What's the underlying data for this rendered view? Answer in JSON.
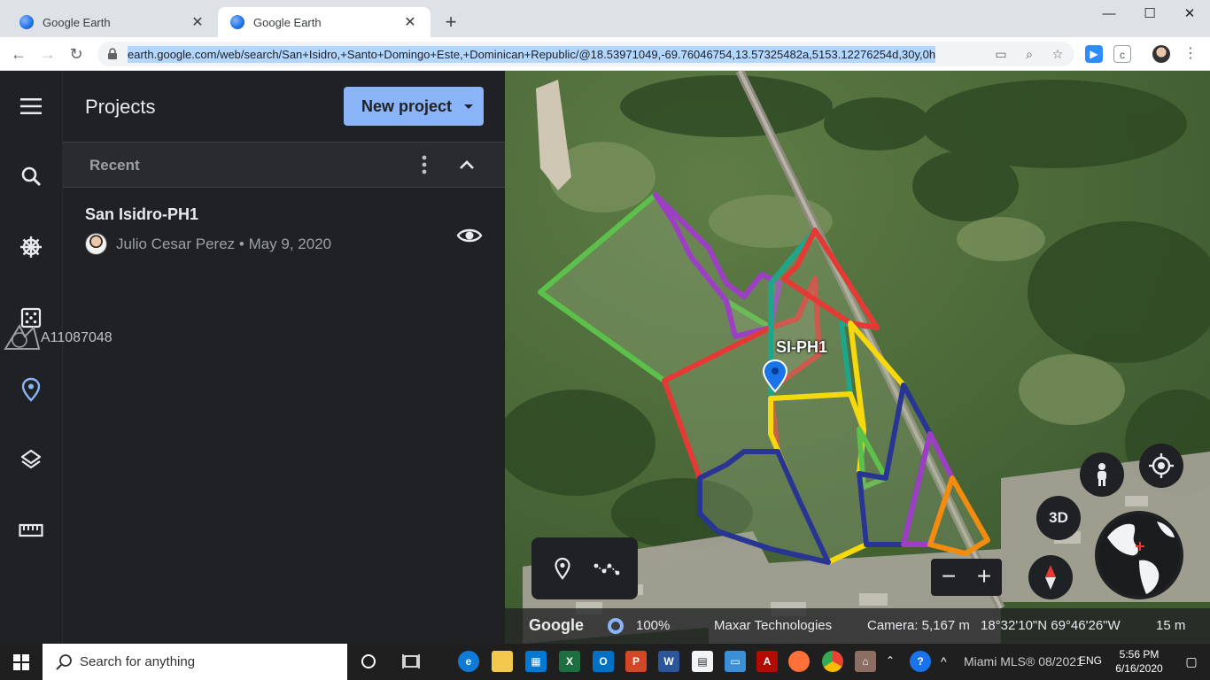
{
  "browser": {
    "tabs": [
      {
        "title": "Google Earth",
        "active": false
      },
      {
        "title": "Google Earth",
        "active": true
      }
    ],
    "url": "earth.google.com/web/search/San+Isidro,+Santo+Domingo+Este,+Dominican+Republic/@18.53971049,-69.76046754,13.57325482a,5153.12276254d,30y,0h"
  },
  "panel": {
    "title": "Projects",
    "new_project_label": "New project",
    "recent_label": "Recent",
    "project": {
      "name": "San Isidro-PH1",
      "meta": "Julio Cesar Perez • May 9, 2020"
    },
    "watermark_id": "A11087048"
  },
  "map": {
    "placemark_label": "SI-PH1",
    "btn_3d": "3D",
    "zoom_out": "−",
    "zoom_in": "+",
    "status": {
      "logo": "Google",
      "percent": "100%",
      "attribution": "Maxar Technologies",
      "camera": "Camera: 5,167 m",
      "coords": "18°32'10\"N 69°46'26\"W",
      "scale": "15 m"
    },
    "polygon_colors": {
      "green": "#5cc14a",
      "purple": "#9c3fc4",
      "red": "#e53935",
      "teal": "#1fa58a",
      "yellow": "#f5d90c",
      "blue": "#283593",
      "orange": "#f28c0f"
    }
  },
  "taskbar": {
    "search_placeholder": "Search for anything",
    "tray_lang": "ENG",
    "tray_watermark": "Miami MLS® 08/2021",
    "time": "5:56 PM",
    "date": "6/16/2020"
  }
}
